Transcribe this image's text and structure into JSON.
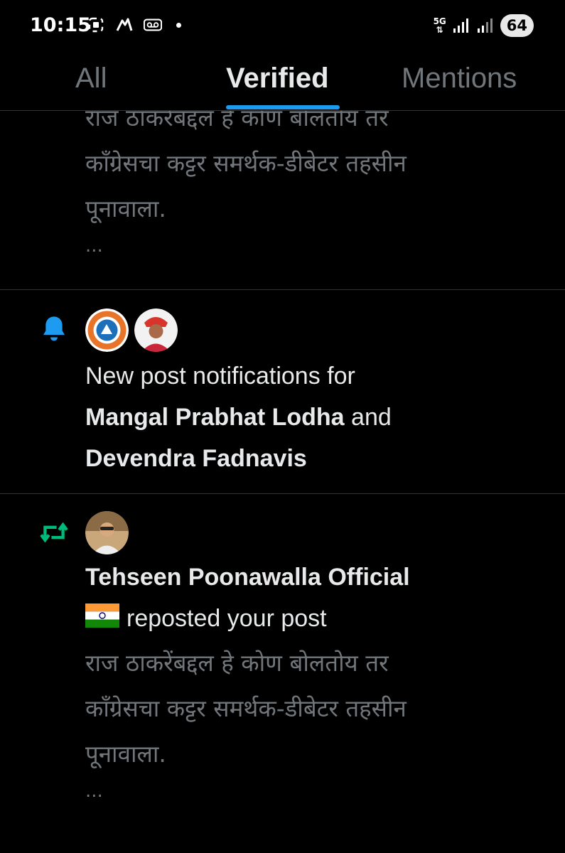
{
  "status": {
    "time": "10:15",
    "net": "5G",
    "battery": "64"
  },
  "tabs": {
    "all": "All",
    "verified": "Verified",
    "mentions": "Mentions"
  },
  "notifications": [
    {
      "type": "repost-truncated",
      "line1": "राज ठाकरेंबद्दल हे कोण बोलतोय तर",
      "line2": "काँग्रेसचा कट्टर समर्थक-डीबेटर तहसीन",
      "line3": "पूनावाला.",
      "more": "..."
    },
    {
      "type": "new-post",
      "icon": "bell-icon",
      "prefix": "New post notifications for",
      "name1": "Mangal Prabhat Lodha",
      "joiner": "and",
      "name2": "Devendra Fadnavis"
    },
    {
      "type": "repost",
      "icon": "repost-icon",
      "name": "Tehseen Poonawalla Official",
      "action": "reposted your post",
      "line1": "राज ठाकरेंबद्दल हे कोण बोलतोय तर",
      "line2": "काँग्रेसचा कट्टर समर्थक-डीबेटर तहसीन",
      "line3": "पूनावाला.",
      "more": "..."
    }
  ],
  "colors": {
    "accent": "#1d9bf0",
    "repost": "#00ba7c",
    "muted": "#71767b"
  }
}
